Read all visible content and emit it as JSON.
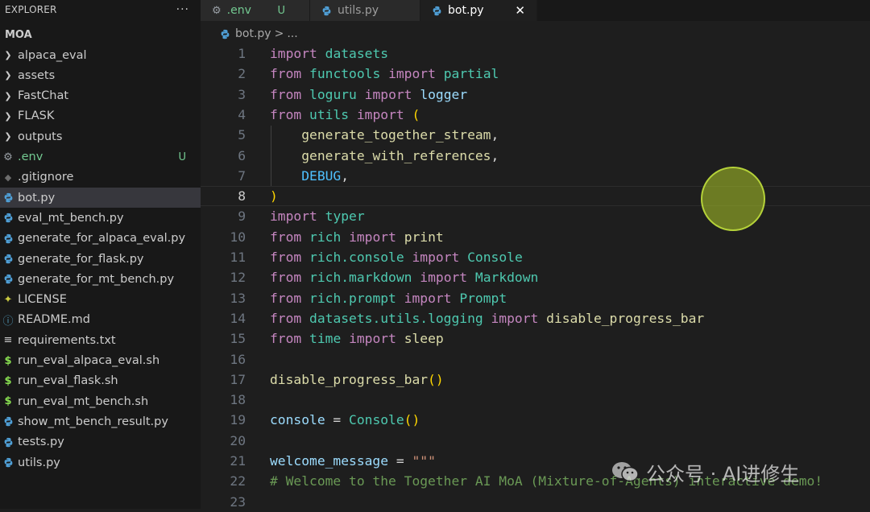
{
  "explorer": {
    "header": "EXPLORER",
    "more": "···",
    "project": "MOA",
    "items": [
      {
        "label": "alpaca_eval",
        "type": "folder"
      },
      {
        "label": "assets",
        "type": "folder"
      },
      {
        "label": "FastChat",
        "type": "folder"
      },
      {
        "label": "FLASK",
        "type": "folder"
      },
      {
        "label": "outputs",
        "type": "folder"
      },
      {
        "label": ".env",
        "type": "env",
        "badge": "U"
      },
      {
        "label": ".gitignore",
        "type": "git"
      },
      {
        "label": "bot.py",
        "type": "py",
        "active": true
      },
      {
        "label": "eval_mt_bench.py",
        "type": "py"
      },
      {
        "label": "generate_for_alpaca_eval.py",
        "type": "py"
      },
      {
        "label": "generate_for_flask.py",
        "type": "py"
      },
      {
        "label": "generate_for_mt_bench.py",
        "type": "py"
      },
      {
        "label": "LICENSE",
        "type": "license"
      },
      {
        "label": "README.md",
        "type": "info"
      },
      {
        "label": "requirements.txt",
        "type": "txt"
      },
      {
        "label": "run_eval_alpaca_eval.sh",
        "type": "sh"
      },
      {
        "label": "run_eval_flask.sh",
        "type": "sh"
      },
      {
        "label": "run_eval_mt_bench.sh",
        "type": "sh"
      },
      {
        "label": "show_mt_bench_result.py",
        "type": "py"
      },
      {
        "label": "tests.py",
        "type": "py"
      },
      {
        "label": "utils.py",
        "type": "py"
      }
    ]
  },
  "tabs": [
    {
      "label": ".env",
      "icon": "gear-icon",
      "badge": "U"
    },
    {
      "label": "utils.py",
      "icon": "python-icon"
    },
    {
      "label": "bot.py",
      "icon": "python-icon",
      "active": true,
      "close": "✕"
    }
  ],
  "breadcrumb": {
    "file": "bot.py",
    "sep": ">",
    "rest": "..."
  },
  "current_line": 8,
  "code_lines": [
    [
      [
        "kw",
        "import"
      ],
      [
        "p",
        " "
      ],
      [
        "mod",
        "datasets"
      ]
    ],
    [
      [
        "kw",
        "from"
      ],
      [
        "p",
        " "
      ],
      [
        "mod",
        "functools"
      ],
      [
        "p",
        " "
      ],
      [
        "kw",
        "import"
      ],
      [
        "p",
        " "
      ],
      [
        "mod",
        "partial"
      ]
    ],
    [
      [
        "kw",
        "from"
      ],
      [
        "p",
        " "
      ],
      [
        "mod",
        "loguru"
      ],
      [
        "p",
        " "
      ],
      [
        "kw",
        "import"
      ],
      [
        "p",
        " "
      ],
      [
        "var",
        "logger"
      ]
    ],
    [
      [
        "kw",
        "from"
      ],
      [
        "p",
        " "
      ],
      [
        "mod",
        "utils"
      ],
      [
        "p",
        " "
      ],
      [
        "kw",
        "import"
      ],
      [
        "p",
        " "
      ],
      [
        "brk",
        "("
      ]
    ],
    [
      [
        "p",
        "    "
      ],
      [
        "fn",
        "generate_together_stream"
      ],
      [
        "p",
        ","
      ]
    ],
    [
      [
        "p",
        "    "
      ],
      [
        "fn",
        "generate_with_references"
      ],
      [
        "p",
        ","
      ]
    ],
    [
      [
        "p",
        "    "
      ],
      [
        "const",
        "DEBUG"
      ],
      [
        "p",
        ","
      ]
    ],
    [
      [
        "brk",
        ")"
      ]
    ],
    [
      [
        "kw",
        "import"
      ],
      [
        "p",
        " "
      ],
      [
        "mod",
        "typer"
      ]
    ],
    [
      [
        "kw",
        "from"
      ],
      [
        "p",
        " "
      ],
      [
        "mod",
        "rich"
      ],
      [
        "p",
        " "
      ],
      [
        "kw",
        "import"
      ],
      [
        "p",
        " "
      ],
      [
        "fn",
        "print"
      ]
    ],
    [
      [
        "kw",
        "from"
      ],
      [
        "p",
        " "
      ],
      [
        "mod",
        "rich.console"
      ],
      [
        "p",
        " "
      ],
      [
        "kw",
        "import"
      ],
      [
        "p",
        " "
      ],
      [
        "mod",
        "Console"
      ]
    ],
    [
      [
        "kw",
        "from"
      ],
      [
        "p",
        " "
      ],
      [
        "mod",
        "rich.markdown"
      ],
      [
        "p",
        " "
      ],
      [
        "kw",
        "import"
      ],
      [
        "p",
        " "
      ],
      [
        "mod",
        "Markdown"
      ]
    ],
    [
      [
        "kw",
        "from"
      ],
      [
        "p",
        " "
      ],
      [
        "mod",
        "rich.prompt"
      ],
      [
        "p",
        " "
      ],
      [
        "kw",
        "import"
      ],
      [
        "p",
        " "
      ],
      [
        "mod",
        "Prompt"
      ]
    ],
    [
      [
        "kw",
        "from"
      ],
      [
        "p",
        " "
      ],
      [
        "mod",
        "datasets.utils.logging"
      ],
      [
        "p",
        " "
      ],
      [
        "kw",
        "import"
      ],
      [
        "p",
        " "
      ],
      [
        "fn",
        "disable_progress_bar"
      ]
    ],
    [
      [
        "kw",
        "from"
      ],
      [
        "p",
        " "
      ],
      [
        "mod",
        "time"
      ],
      [
        "p",
        " "
      ],
      [
        "kw",
        "import"
      ],
      [
        "p",
        " "
      ],
      [
        "fn",
        "sleep"
      ]
    ],
    [],
    [
      [
        "fn",
        "disable_progress_bar"
      ],
      [
        "brk",
        "()"
      ]
    ],
    [],
    [
      [
        "var",
        "console"
      ],
      [
        "p",
        " = "
      ],
      [
        "mod",
        "Console"
      ],
      [
        "brk",
        "()"
      ]
    ],
    [],
    [
      [
        "var",
        "welcome_message"
      ],
      [
        "p",
        " = "
      ],
      [
        "str",
        "\"\"\""
      ]
    ],
    [
      [
        "cm",
        "# Welcome to the Together AI MoA (Mixture-of-Agents) interactive demo!"
      ]
    ],
    []
  ],
  "watermark": "公众号 · AI进修生",
  "colors": {
    "keyword": "#c586c0",
    "module": "#4ec9b0",
    "function": "#dcdcaa",
    "string": "#ce9178",
    "comment": "#6a9955"
  }
}
